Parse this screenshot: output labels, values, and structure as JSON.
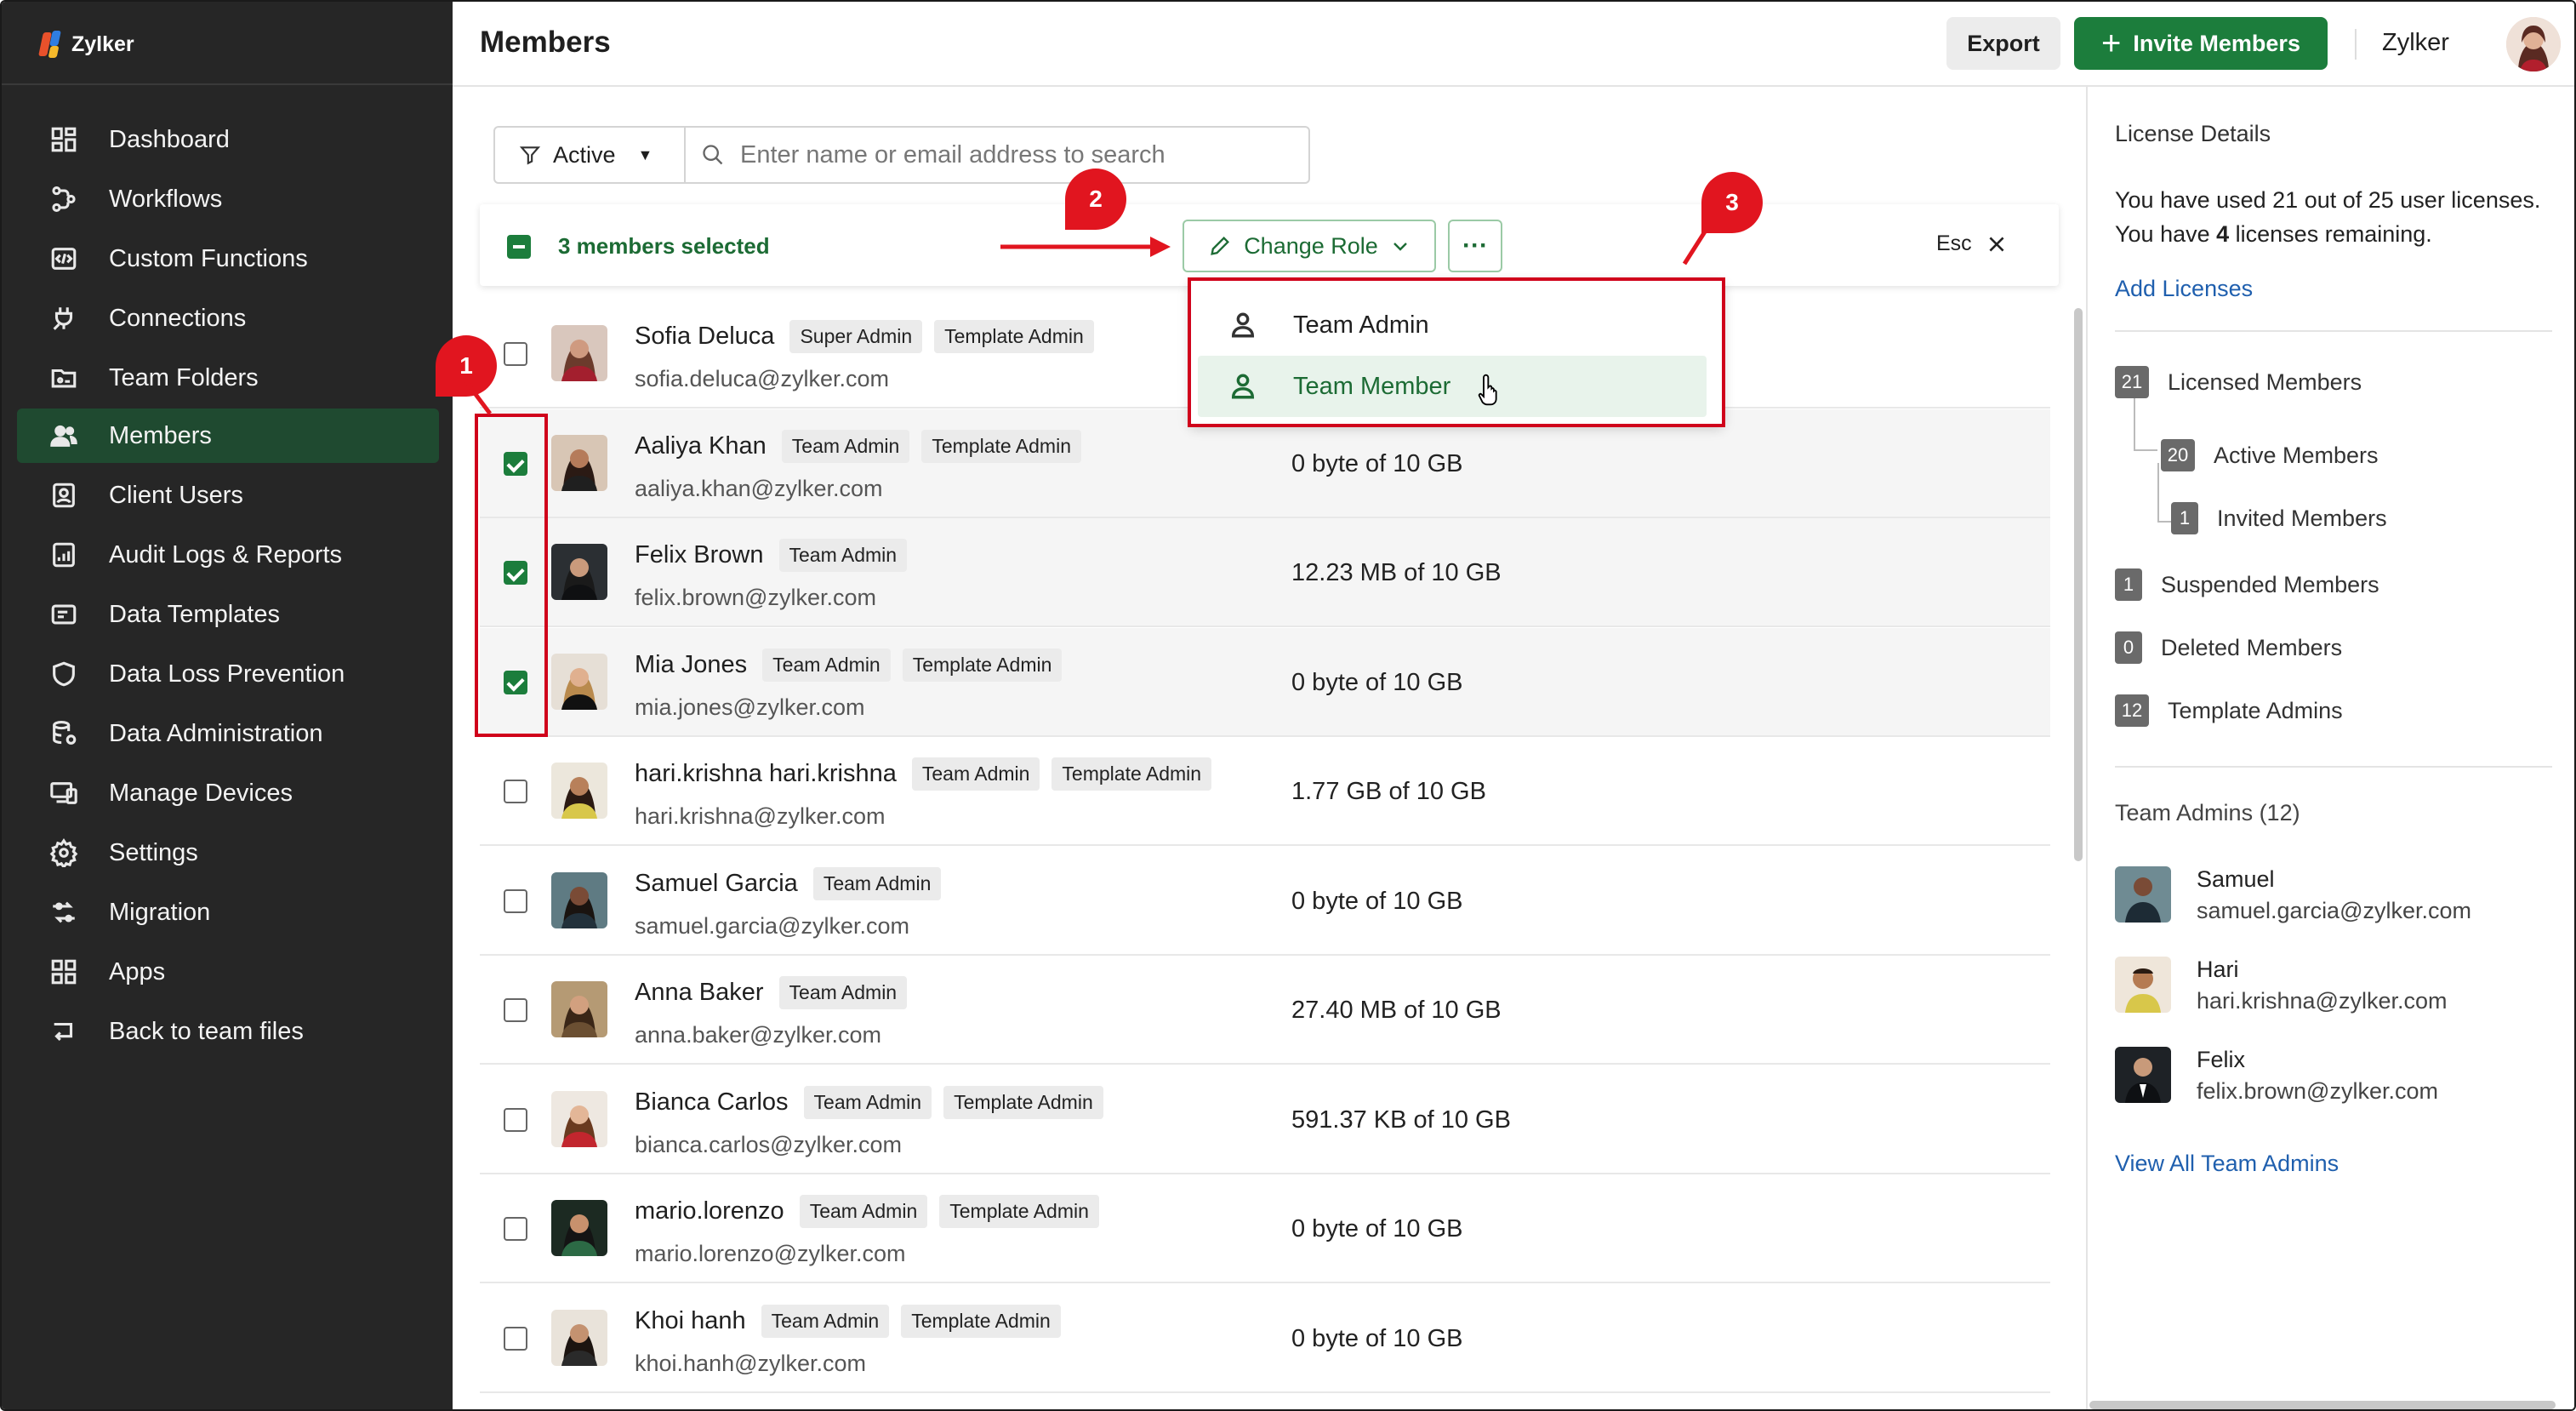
{
  "app": {
    "brand": "Zylker",
    "org_name": "Zylker"
  },
  "sidebar": {
    "items": [
      {
        "label": "Dashboard",
        "icon": "dashboard-icon"
      },
      {
        "label": "Workflows",
        "icon": "workflow-icon"
      },
      {
        "label": "Custom Functions",
        "icon": "code-icon"
      },
      {
        "label": "Connections",
        "icon": "plug-icon"
      },
      {
        "label": "Team Folders",
        "icon": "folder-icon"
      },
      {
        "label": "Members",
        "icon": "users-icon",
        "active": true
      },
      {
        "label": "Client Users",
        "icon": "id-card-icon"
      },
      {
        "label": "Audit Logs & Reports",
        "icon": "report-icon"
      },
      {
        "label": "Data Templates",
        "icon": "template-icon"
      },
      {
        "label": "Data Loss Prevention",
        "icon": "shield-icon"
      },
      {
        "label": "Data Administration",
        "icon": "database-icon"
      },
      {
        "label": "Manage Devices",
        "icon": "devices-icon"
      },
      {
        "label": "Settings",
        "icon": "gear-icon"
      },
      {
        "label": "Migration",
        "icon": "migration-icon"
      },
      {
        "label": "Apps",
        "icon": "apps-icon"
      },
      {
        "label": "Back to team files",
        "icon": "back-icon"
      }
    ]
  },
  "header": {
    "title": "Members",
    "export_label": "Export",
    "invite_label": "Invite Members"
  },
  "filter": {
    "status": "Active",
    "search_placeholder": "Enter name or email address to search"
  },
  "selection": {
    "label": "3 members selected",
    "change_role_label": "Change Role",
    "more_label": "···",
    "esc_label": "Esc"
  },
  "role_menu": {
    "items": [
      "Team Admin",
      "Team Member"
    ],
    "hovered": "Team Member"
  },
  "annotations": [
    "1",
    "2",
    "3"
  ],
  "members": [
    {
      "name": "Sofia Deluca",
      "email": "sofia.deluca@zylker.com",
      "badges": [
        "Super Admin",
        "Template Admin"
      ],
      "storage": "",
      "selected": false
    },
    {
      "name": "Aaliya Khan",
      "email": "aaliya.khan@zylker.com",
      "badges": [
        "Team Admin",
        "Template Admin"
      ],
      "storage": "0 byte of 10 GB",
      "selected": true
    },
    {
      "name": "Felix Brown",
      "email": "felix.brown@zylker.com",
      "badges": [
        "Team Admin"
      ],
      "storage": "12.23 MB of 10 GB",
      "selected": true
    },
    {
      "name": "Mia Jones",
      "email": "mia.jones@zylker.com",
      "badges": [
        "Team Admin",
        "Template Admin"
      ],
      "storage": "0 byte of 10 GB",
      "selected": true
    },
    {
      "name": "hari.krishna hari.krishna",
      "email": "hari.krishna@zylker.com",
      "badges": [
        "Team Admin",
        "Template Admin"
      ],
      "storage": "1.77 GB of 10 GB",
      "selected": false
    },
    {
      "name": "Samuel Garcia",
      "email": "samuel.garcia@zylker.com",
      "badges": [
        "Team Admin"
      ],
      "storage": "0 byte of 10 GB",
      "selected": false
    },
    {
      "name": "Anna Baker",
      "email": "anna.baker@zylker.com",
      "badges": [
        "Team Admin"
      ],
      "storage": "27.40 MB of 10 GB",
      "selected": false
    },
    {
      "name": "Bianca Carlos",
      "email": "bianca.carlos@zylker.com",
      "badges": [
        "Team Admin",
        "Template Admin"
      ],
      "storage": "591.37 KB of 10 GB",
      "selected": false
    },
    {
      "name": "mario.lorenzo",
      "email": "mario.lorenzo@zylker.com",
      "badges": [
        "Team Admin",
        "Template Admin"
      ],
      "storage": "0 byte of 10 GB",
      "selected": false
    },
    {
      "name": "Khoi hanh",
      "email": "khoi.hanh@zylker.com",
      "badges": [
        "Team Admin",
        "Template Admin"
      ],
      "storage": "0 byte of 10 GB",
      "selected": false
    }
  ],
  "license": {
    "title": "License Details",
    "line1": "You have used 21 out of 25 user licenses.",
    "line2_pre": "You have ",
    "line2_num": "4",
    "line2_post": " licenses remaining.",
    "add_link": "Add Licenses",
    "stats": [
      {
        "count": "21",
        "label": "Licensed Members"
      },
      {
        "count": "20",
        "label": "Active Members"
      },
      {
        "count": "1",
        "label": "Invited Members"
      },
      {
        "count": "1",
        "label": "Suspended Members"
      },
      {
        "count": "0",
        "label": "Deleted Members"
      },
      {
        "count": "12",
        "label": "Template Admins"
      }
    ]
  },
  "team_admins": {
    "title": "Team Admins (12)",
    "list": [
      {
        "name": "Samuel",
        "email": "samuel.garcia@zylker.com"
      },
      {
        "name": "Hari",
        "email": "hari.krishna@zylker.com"
      },
      {
        "name": "Felix",
        "email": "felix.brown@zylker.com"
      }
    ],
    "view_all": "View All Team Admins"
  },
  "colors": {
    "sidebar_bg": "#262626",
    "active_nav": "#1f4a30",
    "brand_green": "#1c7d3c",
    "annotation_red": "#d0021b",
    "link_blue": "#1f5fae"
  }
}
